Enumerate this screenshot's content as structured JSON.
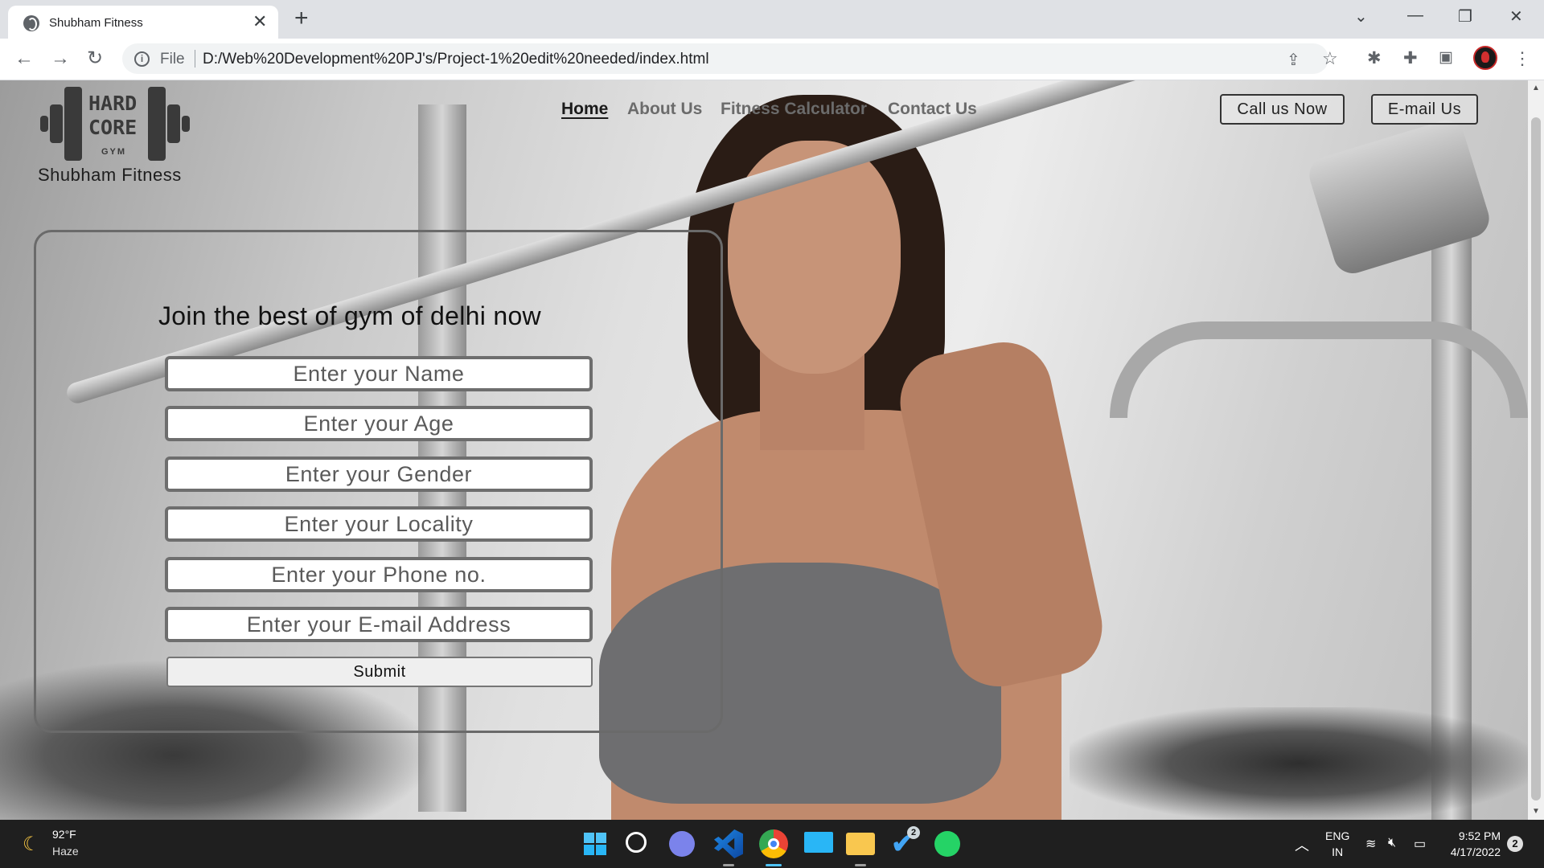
{
  "browser": {
    "tab_title": "Shubham Fitness",
    "tab_close": "✕",
    "new_tab": "+",
    "window_controls": {
      "collapse": "⌄",
      "minimize": "—",
      "restore": "❐",
      "close": "✕"
    },
    "nav": {
      "back": "←",
      "forward": "→",
      "reload": "↻"
    },
    "address_scheme": "File",
    "url": "D:/Web%20Development%20PJ's/Project-1%20edit%20needed/index.html",
    "toolbar_icons": [
      "share-icon",
      "bookmark-star-icon",
      "bug-extension-icon",
      "puzzle-extensions-icon",
      "side-panel-icon",
      "profile-avatar",
      "more-menu-icon"
    ]
  },
  "site": {
    "logo": {
      "line1": "HARD",
      "line2": "CORE",
      "line3": "GYM"
    },
    "brand_name": "Shubham Fitness",
    "nav": [
      {
        "label": "Home",
        "active": true
      },
      {
        "label": "About Us",
        "active": false
      },
      {
        "label": "Fitness Calculator",
        "active": false
      },
      {
        "label": "Contact Us",
        "active": false
      }
    ],
    "buttons": {
      "call": "Call us Now",
      "email": "E-mail Us"
    }
  },
  "form": {
    "title": "Join the best of gym of delhi now",
    "fields": [
      {
        "placeholder": "Enter your Name",
        "value": ""
      },
      {
        "placeholder": "Enter your Age",
        "value": ""
      },
      {
        "placeholder": "Enter your Gender",
        "value": ""
      },
      {
        "placeholder": "Enter your Locality",
        "value": ""
      },
      {
        "placeholder": "Enter your Phone no.",
        "value": ""
      },
      {
        "placeholder": "Enter your E-mail Address",
        "value": ""
      }
    ],
    "submit": "Submit"
  },
  "taskbar": {
    "weather": {
      "temp": "92°F",
      "condition": "Haze"
    },
    "apps": [
      "windows-start",
      "search",
      "teams-chat",
      "vscode",
      "chrome",
      "remote-desktop",
      "file-explorer",
      "todo",
      "whatsapp"
    ],
    "tray": {
      "lang_line1": "ENG",
      "lang_line2": "IN",
      "time": "9:52 PM",
      "date": "4/17/2022",
      "notifications": "2",
      "todo_badge": "2"
    }
  }
}
